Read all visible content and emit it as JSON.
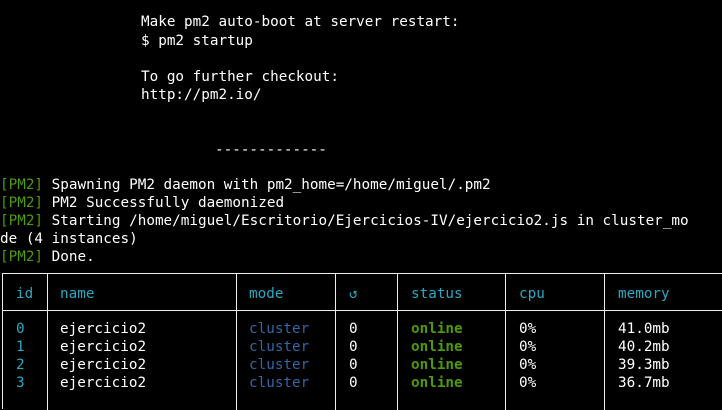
{
  "terminal": {
    "startup_heading": "Make pm2 auto-boot at server restart:",
    "startup_command": "$ pm2 startup",
    "further_heading": "To go further checkout:",
    "further_url": "http://pm2.io/",
    "separator": "-------------",
    "log": [
      {
        "tag": "[PM2]",
        "text": " Spawning PM2 daemon with pm2_home=/home/miguel/.pm2"
      },
      {
        "tag": "[PM2]",
        "text": " PM2 Successfully daemonized"
      },
      {
        "tag": "[PM2]",
        "text": " Starting /home/miguel/Escritorio/Ejercicios-IV/ejercicio2.js in cluster_mo"
      }
    ],
    "wrap_continuation": "de (4 instances)",
    "done": {
      "tag": "[PM2]",
      "text": " Done."
    }
  },
  "table": {
    "headers": {
      "id": "id",
      "name": "name",
      "mode": "mode",
      "restarts": "↺",
      "status": "status",
      "cpu": "cpu",
      "memory": "memory"
    },
    "rows": [
      {
        "id": "0",
        "name": "ejercicio2",
        "mode": "cluster",
        "restarts": "0",
        "status": "online",
        "cpu": "0%",
        "memory": "41.0mb"
      },
      {
        "id": "1",
        "name": "ejercicio2",
        "mode": "cluster",
        "restarts": "0",
        "status": "online",
        "cpu": "0%",
        "memory": "40.2mb"
      },
      {
        "id": "2",
        "name": "ejercicio2",
        "mode": "cluster",
        "restarts": "0",
        "status": "online",
        "cpu": "0%",
        "memory": "39.3mb"
      },
      {
        "id": "3",
        "name": "ejercicio2",
        "mode": "cluster",
        "restarts": "0",
        "status": "online",
        "cpu": "0%",
        "memory": "36.7mb"
      }
    ]
  },
  "colors": {
    "background": "#000000",
    "text": "#ffffff",
    "pm2_tag": "#4e9a06",
    "header": "#29a8c1",
    "mode": "#3465a4",
    "status_online": "#4e9a06",
    "border": "#eeeeee"
  }
}
